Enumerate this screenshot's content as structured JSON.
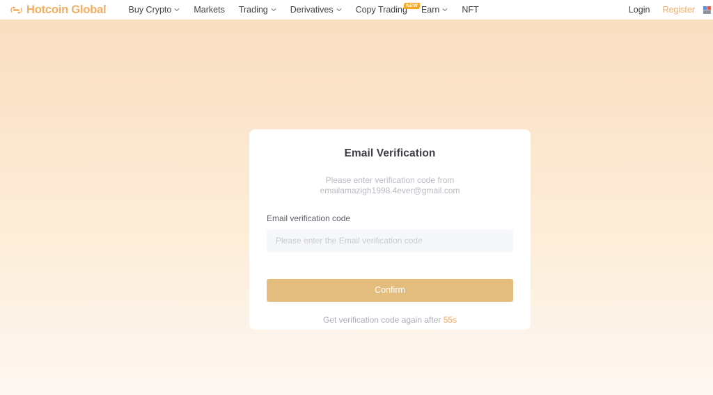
{
  "header": {
    "brand": {
      "logo_icon": "hotcoin-logo-mark",
      "name": "Hotcoin Global",
      "color": "#f2ae64"
    },
    "nav": [
      {
        "label": "Buy Crypto",
        "has_dropdown": true,
        "badge": ""
      },
      {
        "label": "Markets",
        "has_dropdown": false,
        "badge": ""
      },
      {
        "label": "Trading",
        "has_dropdown": true,
        "badge": ""
      },
      {
        "label": "Derivatives",
        "has_dropdown": true,
        "badge": ""
      },
      {
        "label": "Copy Trading",
        "has_dropdown": false,
        "badge": "NEW"
      },
      {
        "label": "Earn",
        "has_dropdown": true,
        "badge": ""
      },
      {
        "label": "NFT",
        "has_dropdown": false,
        "badge": ""
      }
    ],
    "login_label": "Login",
    "register_label": "Register",
    "language_icon": "globe-icon"
  },
  "card": {
    "title": "Email Verification",
    "description": "Please enter verification code from emailamazigh1998.4ever@gmail.com",
    "email": "emailamazigh1998.4ever@gmail.com",
    "field_label": "Email verification code",
    "input_value": "",
    "input_placeholder": "Please enter the Email verification code",
    "confirm_label": "Confirm",
    "resend_prefix": "Get verification code again after ",
    "resend_countdown": "55s"
  },
  "theme": {
    "accent": "#f0ab65",
    "button": "#e3bd7e",
    "badge": "#f5a623",
    "bg_top": "#fadec0",
    "bg_bottom": "#fef7f1",
    "card_bg": "#ffffff"
  }
}
